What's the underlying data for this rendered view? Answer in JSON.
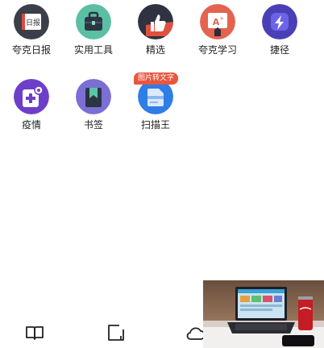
{
  "apps": [
    {
      "name": "app-kuake-daily",
      "label": "夸克日报",
      "icon": "daily-newspaper-icon"
    },
    {
      "name": "app-tools",
      "label": "实用工具",
      "icon": "toolbox-icon"
    },
    {
      "name": "app-featured",
      "label": "精选",
      "icon": "thumbs-up-icon"
    },
    {
      "name": "app-kuake-learn",
      "label": "夸克学习",
      "icon": "learning-board-icon"
    },
    {
      "name": "app-shortcut",
      "label": "捷径",
      "icon": "lightning-icon"
    },
    {
      "name": "app-epidemic",
      "label": "疫情",
      "icon": "medical-kit-icon"
    },
    {
      "name": "app-bookmark",
      "label": "书签",
      "icon": "bookmark-icon"
    },
    {
      "name": "app-scanner",
      "label": "扫描王",
      "icon": "scan-document-icon",
      "badge": "图片转文字"
    }
  ],
  "daily_icon_text": "日报",
  "bottom_nav": [
    {
      "name": "book-icon"
    },
    {
      "name": "tab-square-icon"
    },
    {
      "name": "cloud-icon"
    }
  ],
  "colors": {
    "badge": "#e8573e",
    "text": "#222222"
  }
}
